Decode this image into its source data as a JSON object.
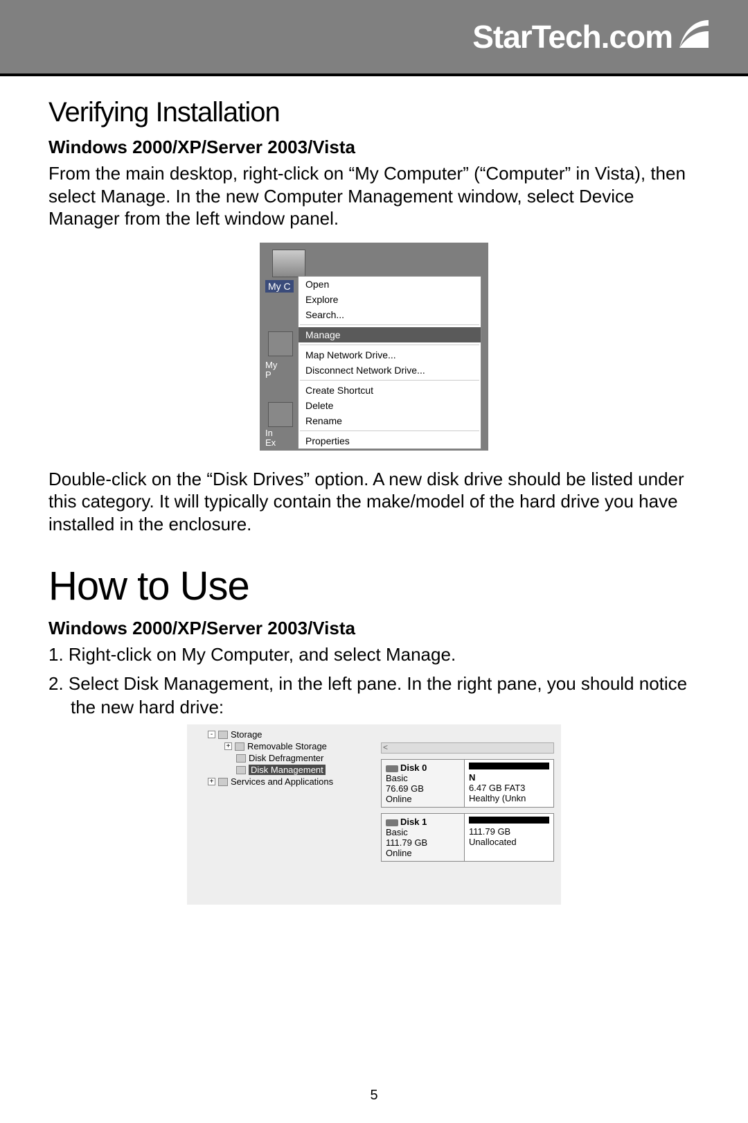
{
  "brand": "StarTech.com",
  "section1": {
    "title": "Verifying Installation",
    "subhead": "Windows 2000/XP/Server 2003/Vista",
    "para1": "From the main desktop, right-click on “My Computer” (“Computer” in Vista), then select Manage. In the new Computer Management window, select Device Manager from the left window panel.",
    "para2": "Double-click on the “Disk Drives” option. A new disk drive should be listed under this category.  It will typically contain the make/model of the hard drive you have installed in the enclosure."
  },
  "ctx_menu": {
    "icon_label_top": "My C",
    "items": [
      "Open",
      "Explore",
      "Search...",
      "SEP",
      "Manage",
      "SEP",
      "Map Network Drive...",
      "Disconnect Network Drive...",
      "SEP",
      "Create Shortcut",
      "Delete",
      "Rename",
      "SEP",
      "Properties"
    ],
    "selected": "Manage",
    "icon_label_mid": "My",
    "icon_label_mid2": "P",
    "icon_label_bot": "In\nEx"
  },
  "section2": {
    "title": "How to Use",
    "subhead": "Windows 2000/XP/Server 2003/Vista",
    "step1": "1. Right-click on My Computer, and select Manage.",
    "step2": "2. Select Disk Management, in the left pane. In the right pane, you should notice the new hard drive:"
  },
  "tree": {
    "items": [
      {
        "indent": 1,
        "exp": "-",
        "label": "Storage"
      },
      {
        "indent": 2,
        "exp": "+",
        "label": "Removable Storage"
      },
      {
        "indent": 2,
        "exp": "",
        "label": "Disk Defragmenter"
      },
      {
        "indent": 2,
        "exp": "",
        "label": "Disk Management",
        "selected": true
      },
      {
        "indent": 1,
        "exp": "+",
        "label": "Services and Applications"
      }
    ]
  },
  "disks": [
    {
      "title": "Disk 0",
      "type": "Basic",
      "size": "76.69 GB",
      "status": "Online",
      "right1": "N",
      "right2": "6.47 GB FAT3",
      "right3": "Healthy (Unkn"
    },
    {
      "title": "Disk 1",
      "type": "Basic",
      "size": "111.79 GB",
      "status": "Online",
      "right1": "",
      "right2": "111.79 GB",
      "right3": "Unallocated"
    }
  ],
  "page_number": "5"
}
